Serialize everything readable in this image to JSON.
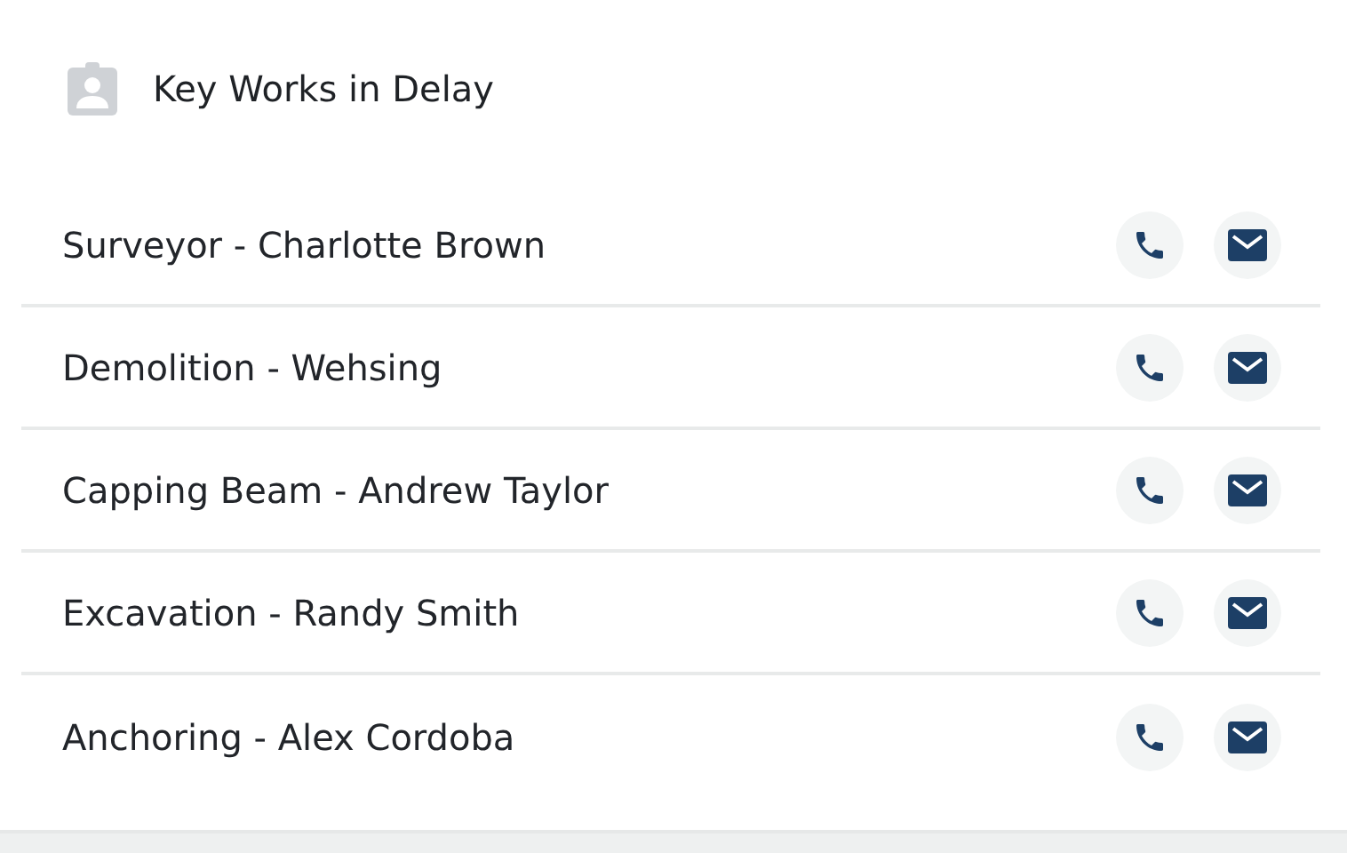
{
  "card": {
    "title": "Key Works in Delay"
  },
  "rows": [
    {
      "label": "Surveyor - Charlotte Brown"
    },
    {
      "label": "Demolition - Wehsing"
    },
    {
      "label": "Capping Beam - Andrew Taylor"
    },
    {
      "label": "Excavation - Randy Smith"
    },
    {
      "label": "Anchoring - Alex Cordoba"
    }
  ]
}
